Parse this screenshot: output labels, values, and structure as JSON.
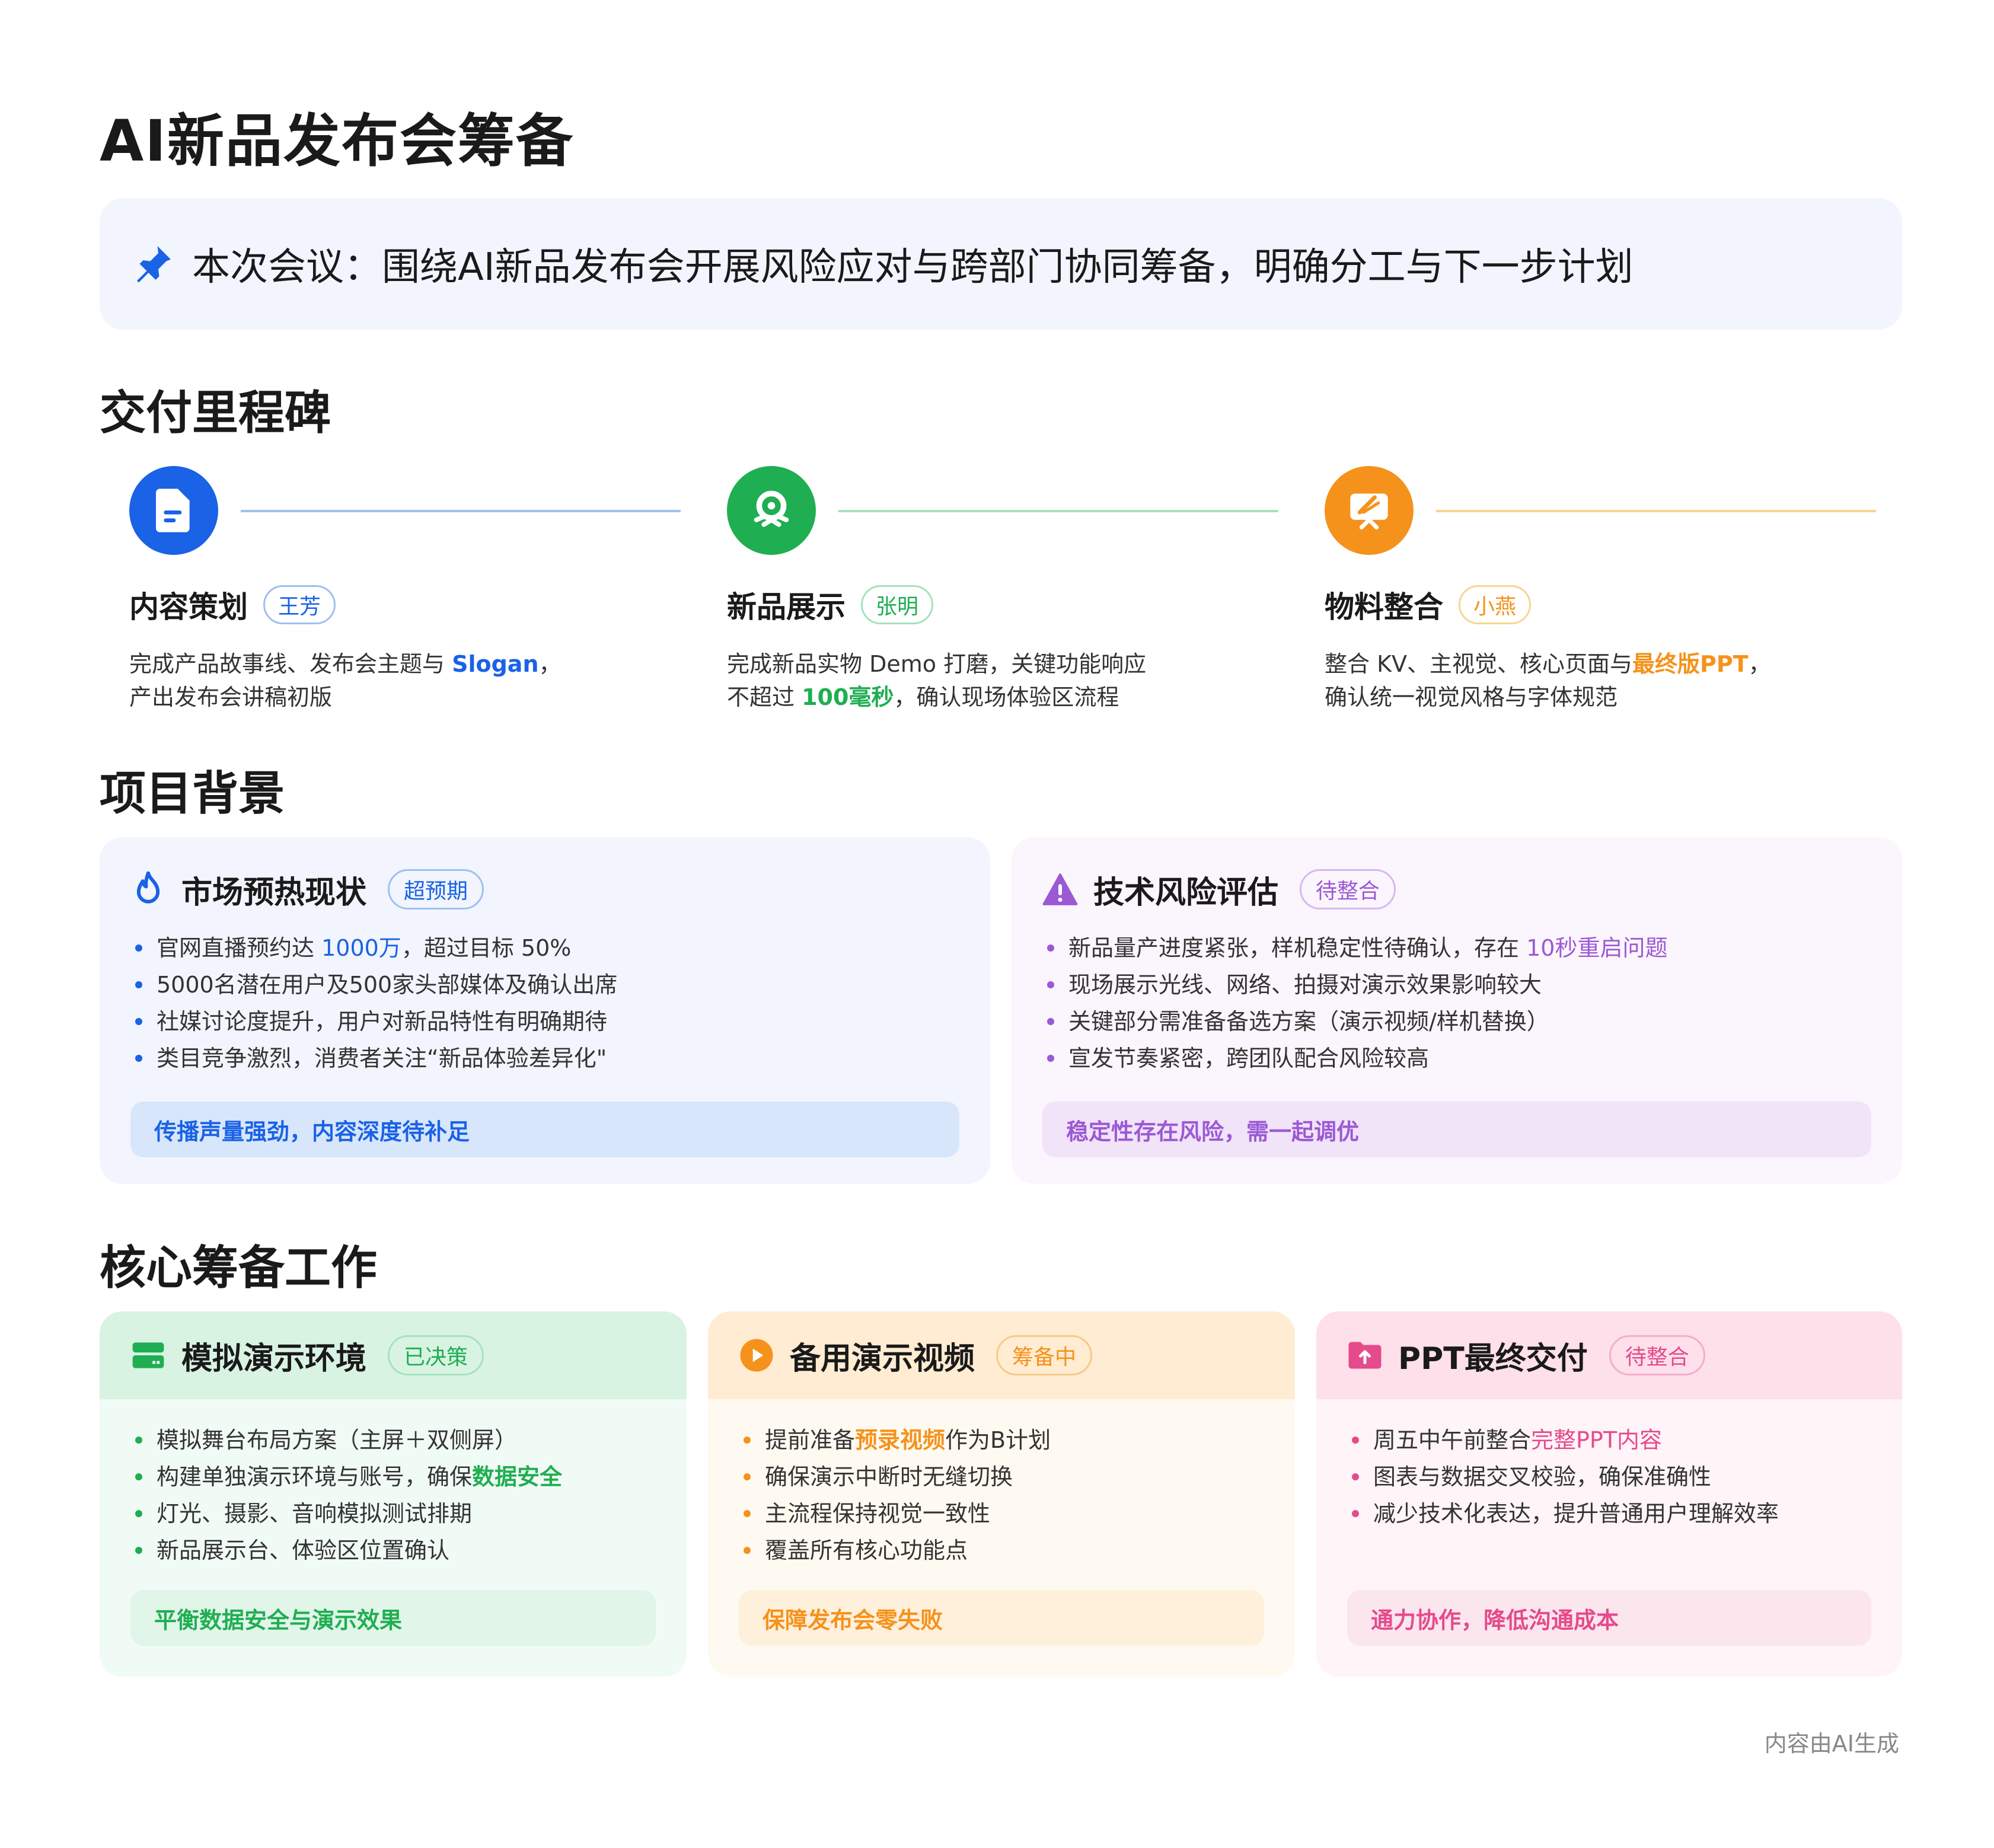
{
  "page": {
    "title": "AI新品发布会筹备",
    "summary": "本次会议：围绕AI新品发布会开展风险应对与跨部门协同筹备，明确分工与下一步计划",
    "footer": "内容由AI生成"
  },
  "sections": {
    "milestones": "交付里程碑",
    "background": "项目背景",
    "core": "核心筹备工作"
  },
  "colors": {
    "blue": "#1a62e6",
    "green": "#1fae52",
    "orange": "#f5921b",
    "purple": "#9b59d4",
    "pink": "#e54a8c"
  },
  "milestones": [
    {
      "icon": "document-icon",
      "name": "内容策划",
      "owner": "王芳",
      "line1_a": "完成产品故事线、发布会主题与 ",
      "line1_hl": "Slogan",
      "line1_b": "，",
      "line2_a": "产出发布会讲稿初版",
      "line2_hl": "",
      "line2_b": ""
    },
    {
      "icon": "award-icon",
      "name": "新品展示",
      "owner": "张明",
      "line1_a": "完成新品实物 Demo 打磨，关键功能响应",
      "line1_hl": "",
      "line1_b": "",
      "line2_a": "不超过 ",
      "line2_hl": "100毫秒",
      "line2_b": "，确认现场体验区流程"
    },
    {
      "icon": "design-icon",
      "name": "物料整合",
      "owner": "小燕",
      "line1_a": "整合 KV、主视觉、核心页面与",
      "line1_hl": "最终版PPT",
      "line1_b": "，",
      "line2_a": "确认统一视觉风格与字体规范",
      "line2_hl": "",
      "line2_b": ""
    }
  ],
  "background": [
    {
      "icon": "fire-icon",
      "title": "市场预热现状",
      "tag": "超预期",
      "items": [
        {
          "a": "官网直播预约达 ",
          "hl": "1000万",
          "b": "，超过目标 50%"
        },
        {
          "a": "5000名潜在用户及500家头部媒体及确认出席",
          "hl": "",
          "b": ""
        },
        {
          "a": "社媒讨论度提升，用户对新品特性有明确期待",
          "hl": "",
          "b": ""
        },
        {
          "a": "类目竞争激烈，消费者关注“新品体验差异化\"",
          "hl": "",
          "b": ""
        }
      ],
      "note": "传播声量强劲，内容深度待补足"
    },
    {
      "icon": "warning-icon",
      "title": "技术风险评估",
      "tag": "待整合",
      "items": [
        {
          "a": "新品量产进度紧张，样机稳定性待确认，存在 ",
          "hl": "10秒重启问题",
          "b": ""
        },
        {
          "a": "现场展示光线、网络、拍摄对演示效果影响较大",
          "hl": "",
          "b": ""
        },
        {
          "a": "关键部分需准备备选方案（演示视频/样机替换）",
          "hl": "",
          "b": ""
        },
        {
          "a": "宣发节奏紧密，跨团队配合风险较高",
          "hl": "",
          "b": ""
        }
      ],
      "note": "稳定性存在风险，需一起调优"
    }
  ],
  "core": [
    {
      "icon": "server-icon",
      "title": "模拟演示环境",
      "tag": "已决策",
      "items": [
        {
          "a": "模拟舞台布局方案（主屏＋双侧屏）",
          "hl": "",
          "b": ""
        },
        {
          "a": "构建单独演示环境与账号，确保",
          "hl": "数据安全",
          "b": ""
        },
        {
          "a": "灯光、摄影、音响模拟测试排期",
          "hl": "",
          "b": ""
        },
        {
          "a": "新品展示台、体验区位置确认",
          "hl": "",
          "b": ""
        }
      ],
      "note": "平衡数据安全与演示效果"
    },
    {
      "icon": "play-icon",
      "title": "备用演示视频",
      "tag": "筹备中",
      "items": [
        {
          "a": "提前准备",
          "hl": "预录视频",
          "b": "作为B计划"
        },
        {
          "a": "确保演示中断时无缝切换",
          "hl": "",
          "b": ""
        },
        {
          "a": "主流程保持视觉一致性",
          "hl": "",
          "b": ""
        },
        {
          "a": "覆盖所有核心功能点",
          "hl": "",
          "b": ""
        }
      ],
      "note": "保障发布会零失败"
    },
    {
      "icon": "folder-upload-icon",
      "title": "PPT最终交付",
      "tag": "待整合",
      "items": [
        {
          "a": "周五中午前整合",
          "hl": "完整PPT内容",
          "b": ""
        },
        {
          "a": "图表与数据交叉校验，确保准确性",
          "hl": "",
          "b": ""
        },
        {
          "a": "减少技术化表达，提升普通用户理解效率",
          "hl": "",
          "b": ""
        }
      ],
      "note": "通力协作，降低沟通成本"
    }
  ]
}
